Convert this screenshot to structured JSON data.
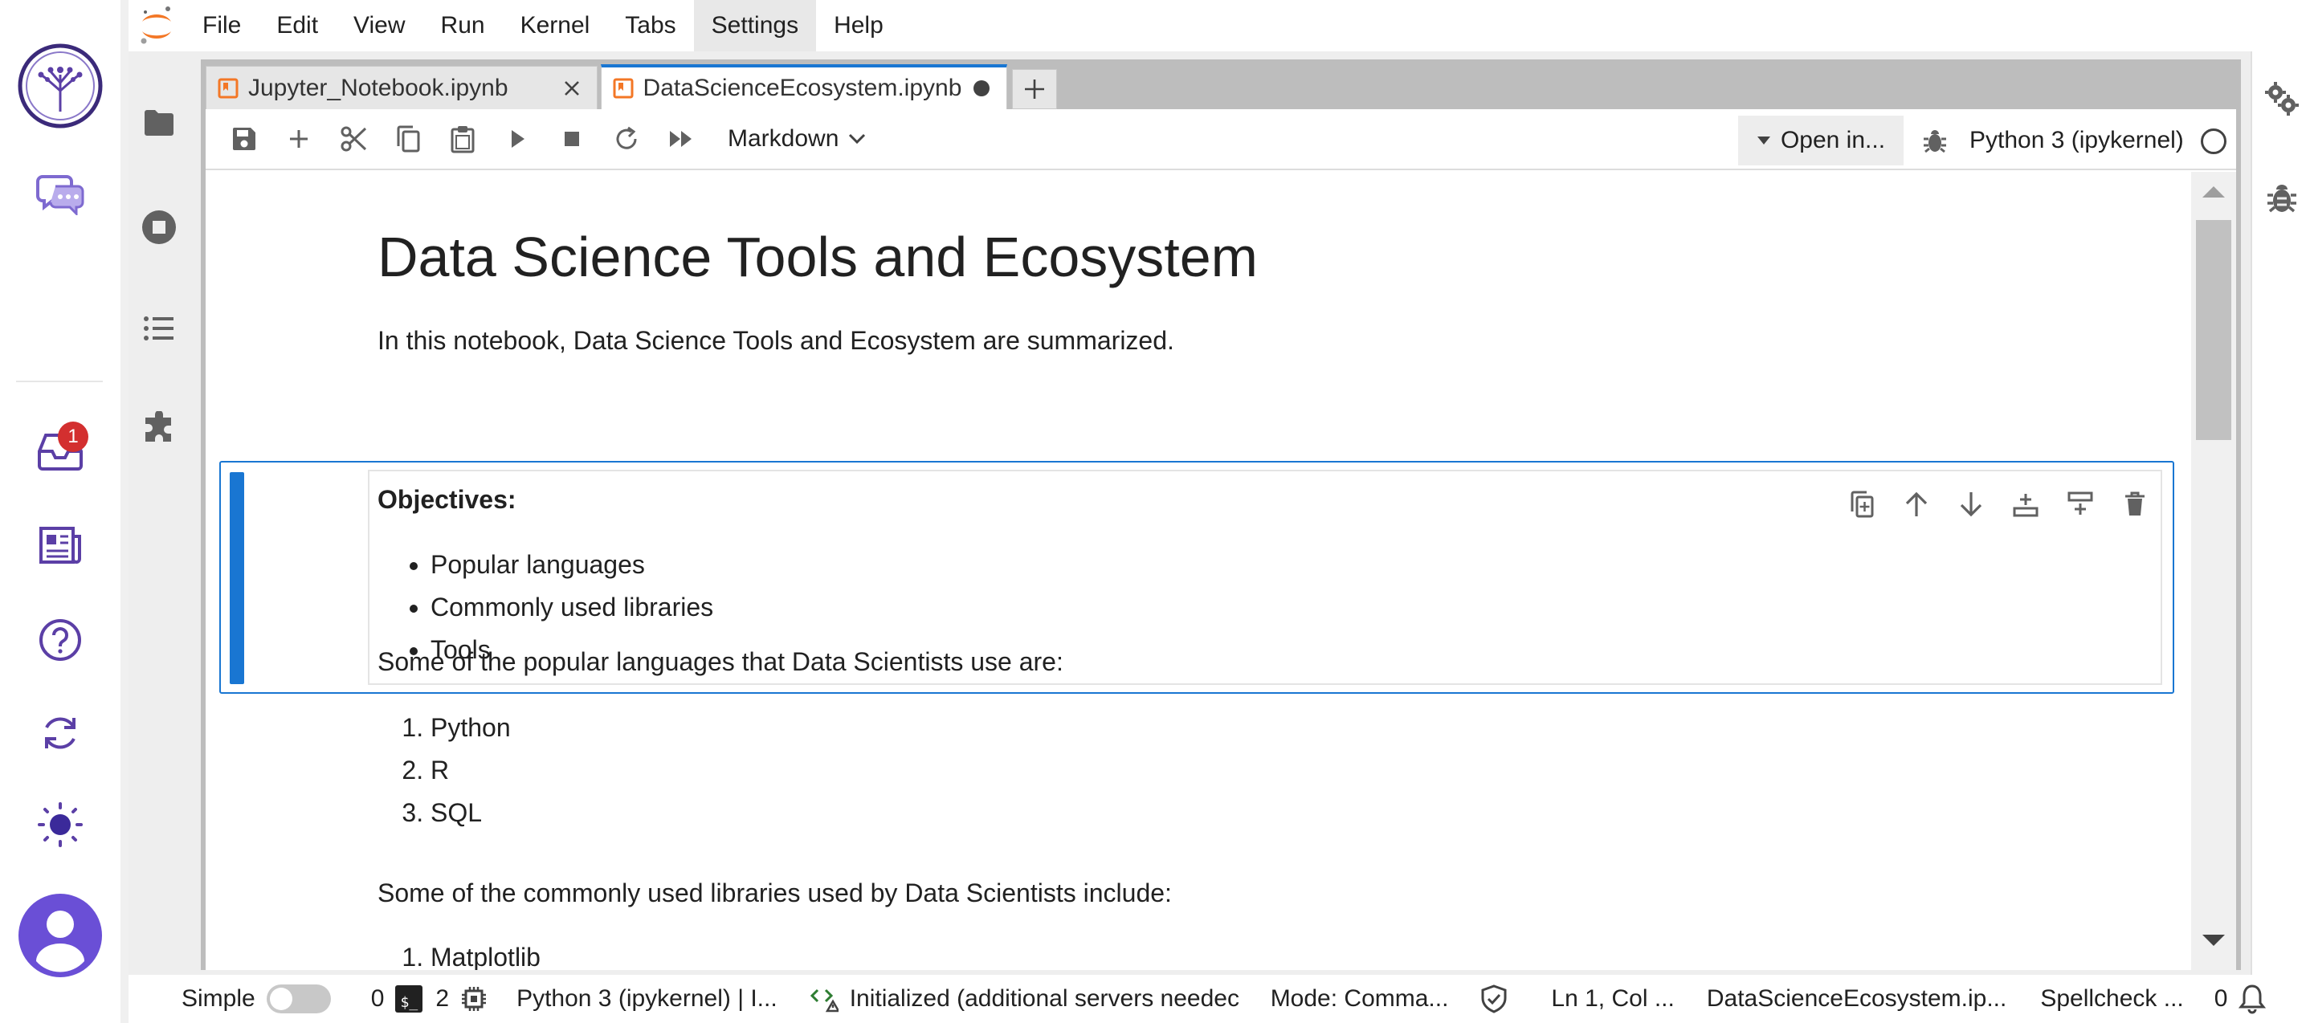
{
  "menubar": {
    "items": [
      "File",
      "Edit",
      "View",
      "Run",
      "Kernel",
      "Tabs",
      "Settings",
      "Help"
    ],
    "active": "Settings"
  },
  "left_rail": {
    "inbox_badge": "1"
  },
  "tabs": [
    {
      "label": "Jupyter_Notebook.ipynb",
      "state": "close"
    },
    {
      "label": "DataScienceEcosystem.ipynb",
      "state": "modified"
    }
  ],
  "toolbar": {
    "cell_type": "Markdown",
    "open_in": "Open in...",
    "kernel": "Python 3 (ipykernel)"
  },
  "notebook": {
    "title": "Data Science Tools and Ecosystem",
    "intro": "In this notebook, Data Science Tools and Ecosystem are summarized.",
    "objectives_heading": "Objectives:",
    "objectives": [
      "Popular languages",
      "Commonly used libraries",
      "Tools"
    ],
    "languages_intro": "Some of the popular languages that Data Scientists use are:",
    "languages": [
      "Python",
      "R",
      "SQL"
    ],
    "libraries_intro": "Some of the commonly used libraries used by Data Scientists include:",
    "libraries": [
      "Matplotlib"
    ]
  },
  "statusbar": {
    "mode_label": "Simple",
    "terminals_count": "0",
    "kernels_count": "2",
    "kernel_status": "Python 3 (ipykernel) | I...",
    "lsp_status": "Initialized (additional servers needec",
    "mode": "Mode: Comma...",
    "position": "Ln 1, Col ...",
    "filename": "DataScienceEcosystem.ip...",
    "spellcheck": "Spellcheck ...",
    "notifications": "0"
  },
  "colors": {
    "accent": "#1976d2",
    "rail_purple": "#5b3fa6",
    "badge_red": "#d32f2f",
    "notebook_orange": "#f37726"
  }
}
